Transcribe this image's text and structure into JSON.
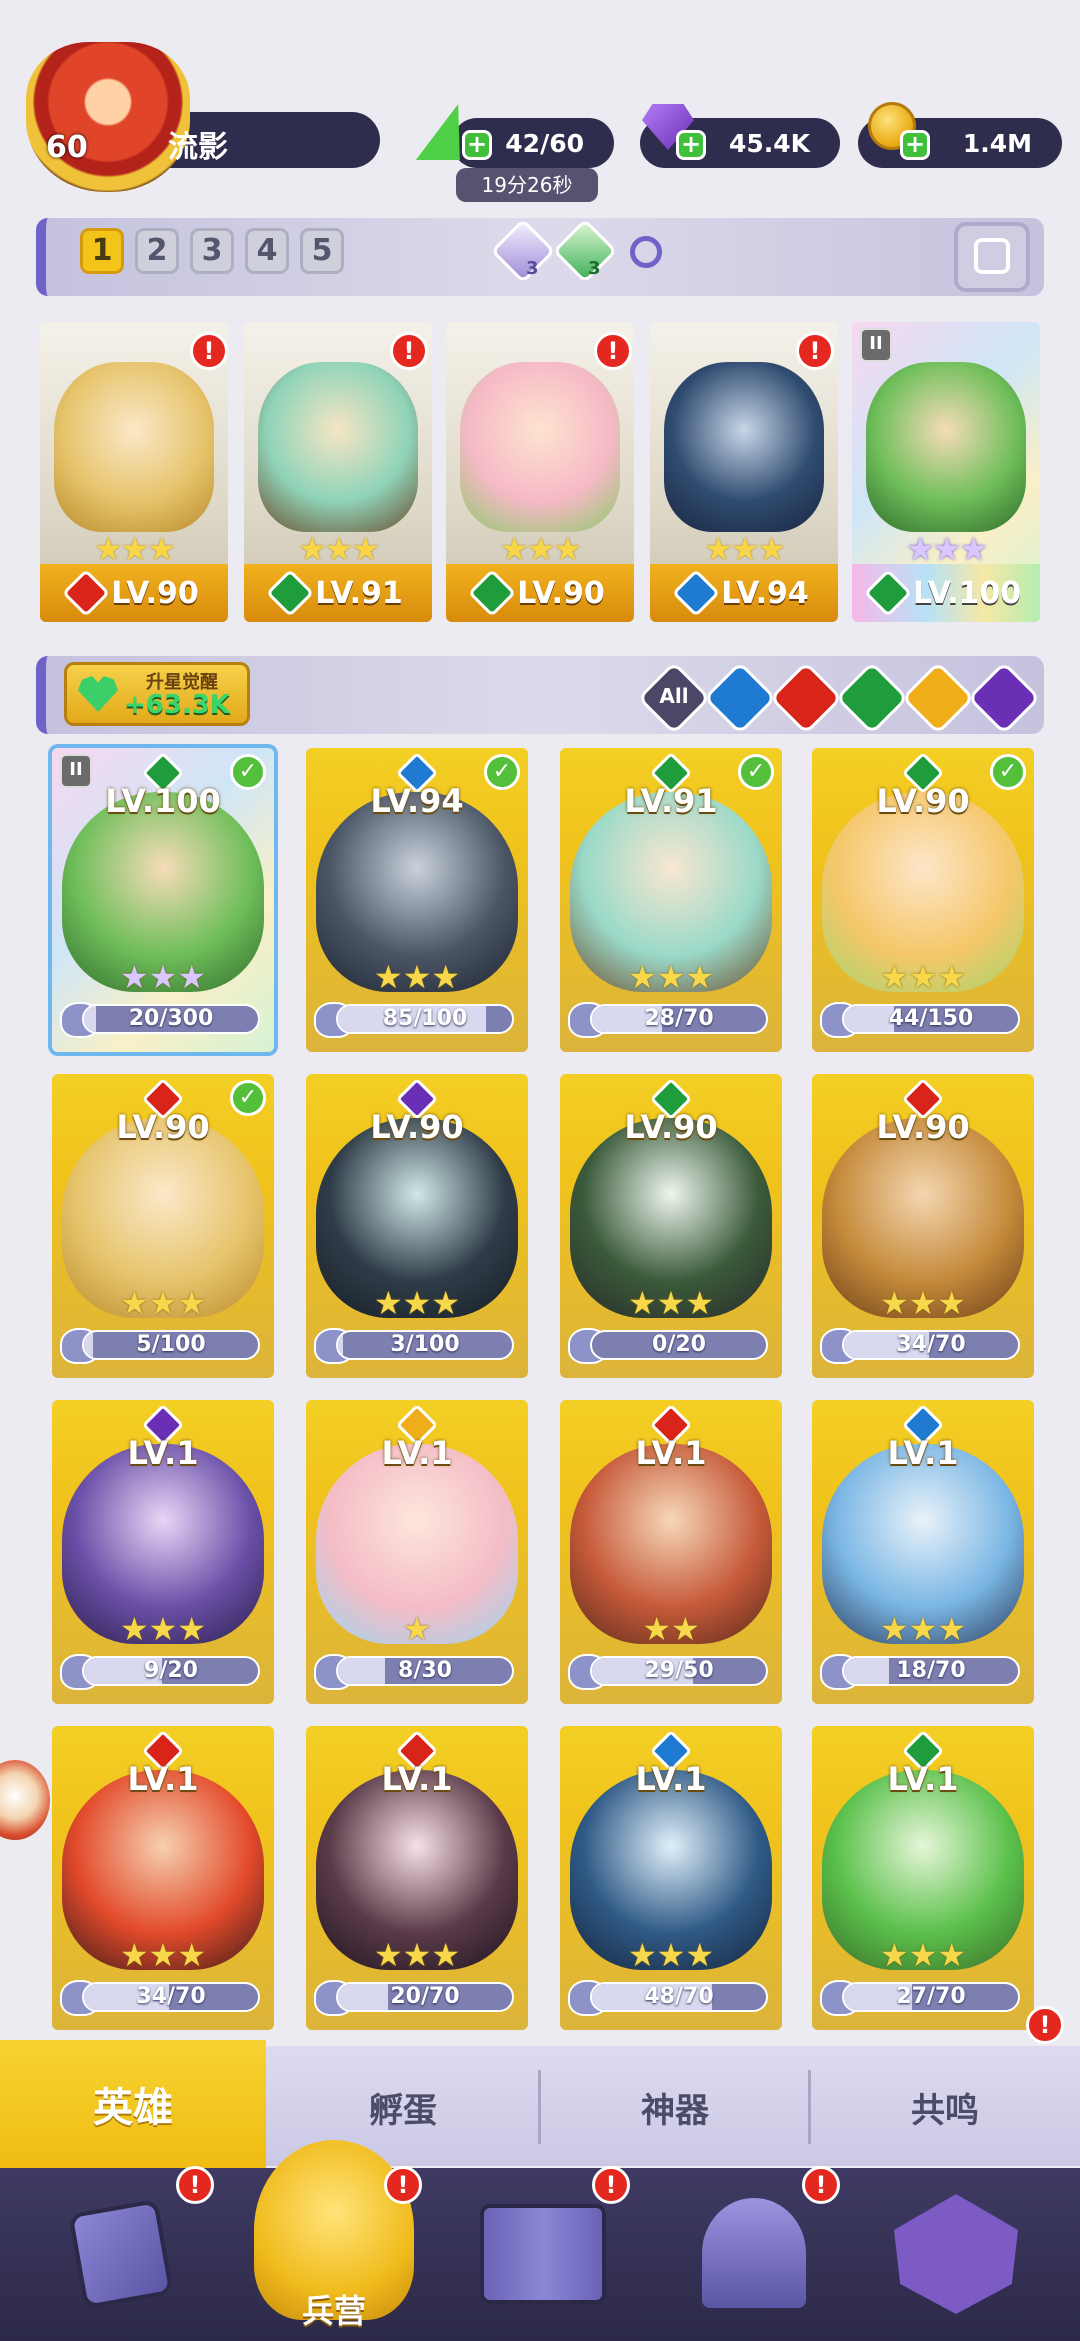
{
  "player": {
    "level": "60",
    "name": "流影",
    "avatar_icon": "player-avatar"
  },
  "resources": {
    "energy": "42/60",
    "energy_timer": "19分26秒",
    "gems": "45.4K",
    "coins": "1.4M"
  },
  "team_tabs": [
    "1",
    "2",
    "3",
    "4",
    "5"
  ],
  "team_boost_counts": [
    "3",
    "3"
  ],
  "team": [
    {
      "level": "LV.90",
      "element": "fire",
      "stars": "★★★",
      "alert": "!"
    },
    {
      "level": "LV.91",
      "element": "nature",
      "stars": "★★★",
      "alert": "!"
    },
    {
      "level": "LV.90",
      "element": "nature",
      "stars": "★★★",
      "alert": "!"
    },
    {
      "level": "LV.94",
      "element": "water",
      "stars": "★★★",
      "alert": "!"
    },
    {
      "level": "LV.100",
      "element": "nature",
      "stars": "★★★",
      "alert": ""
    }
  ],
  "awaken": {
    "label": "升星觉醒",
    "value": "+63.3K"
  },
  "filters": {
    "all": "All",
    "elements": [
      "water",
      "fire",
      "nature",
      "light",
      "dark"
    ]
  },
  "heroes": [
    {
      "level": "LV.100",
      "element": "nature",
      "progress": "20/300",
      "fill": 0.07,
      "stars": "★★★",
      "checked": true
    },
    {
      "level": "LV.94",
      "element": "water",
      "progress": "85/100",
      "fill": 0.85,
      "stars": "★★★",
      "checked": true
    },
    {
      "level": "LV.91",
      "element": "nature",
      "progress": "28/70",
      "fill": 0.4,
      "stars": "★★★",
      "checked": true
    },
    {
      "level": "LV.90",
      "element": "nature",
      "progress": "44/150",
      "fill": 0.29,
      "stars": "★★★",
      "checked": true
    },
    {
      "level": "LV.90",
      "element": "fire",
      "progress": "5/100",
      "fill": 0.05,
      "stars": "★★★",
      "checked": true
    },
    {
      "level": "LV.90",
      "element": "dark",
      "progress": "3/100",
      "fill": 0.03,
      "stars": "★★★",
      "checked": false
    },
    {
      "level": "LV.90",
      "element": "nature",
      "progress": "0/20",
      "fill": 0.0,
      "stars": "★★★",
      "checked": false
    },
    {
      "level": "LV.90",
      "element": "fire",
      "progress": "34/70",
      "fill": 0.49,
      "stars": "★★★",
      "checked": false
    },
    {
      "level": "LV.1",
      "element": "dark",
      "progress": "9/20",
      "fill": 0.45,
      "stars": "★★★",
      "checked": false
    },
    {
      "level": "LV.1",
      "element": "light",
      "progress": "8/30",
      "fill": 0.27,
      "stars": "★",
      "checked": false
    },
    {
      "level": "LV.1",
      "element": "fire",
      "progress": "29/50",
      "fill": 0.58,
      "stars": "★★",
      "checked": false
    },
    {
      "level": "LV.1",
      "element": "water",
      "progress": "18/70",
      "fill": 0.26,
      "stars": "★★★",
      "checked": false
    },
    {
      "level": "LV.1",
      "element": "fire",
      "progress": "34/70",
      "fill": 0.49,
      "stars": "★★★",
      "checked": false
    },
    {
      "level": "LV.1",
      "element": "fire",
      "progress": "20/70",
      "fill": 0.29,
      "stars": "★★★",
      "checked": false
    },
    {
      "level": "LV.1",
      "element": "water",
      "progress": "48/70",
      "fill": 0.69,
      "stars": "★★★",
      "checked": false
    },
    {
      "level": "LV.1",
      "element": "nature",
      "progress": "27/70",
      "fill": 0.39,
      "stars": "★★★",
      "checked": false
    }
  ],
  "sub_tabs": [
    "英雄",
    "孵蛋",
    "神器",
    "共鸣"
  ],
  "bottom_nav": {
    "active_label": "兵营",
    "items": [
      "cards-icon",
      "barracks-icon",
      "map-icon",
      "shrine-icon",
      "mushroom-icon"
    ]
  },
  "colors": {
    "fire": "#d9241a",
    "water": "#1f7bd1",
    "nature": "#1f9c3b",
    "light": "#f0ad1a",
    "dark": "#6a2fb4",
    "accent": "#f3c51a"
  }
}
